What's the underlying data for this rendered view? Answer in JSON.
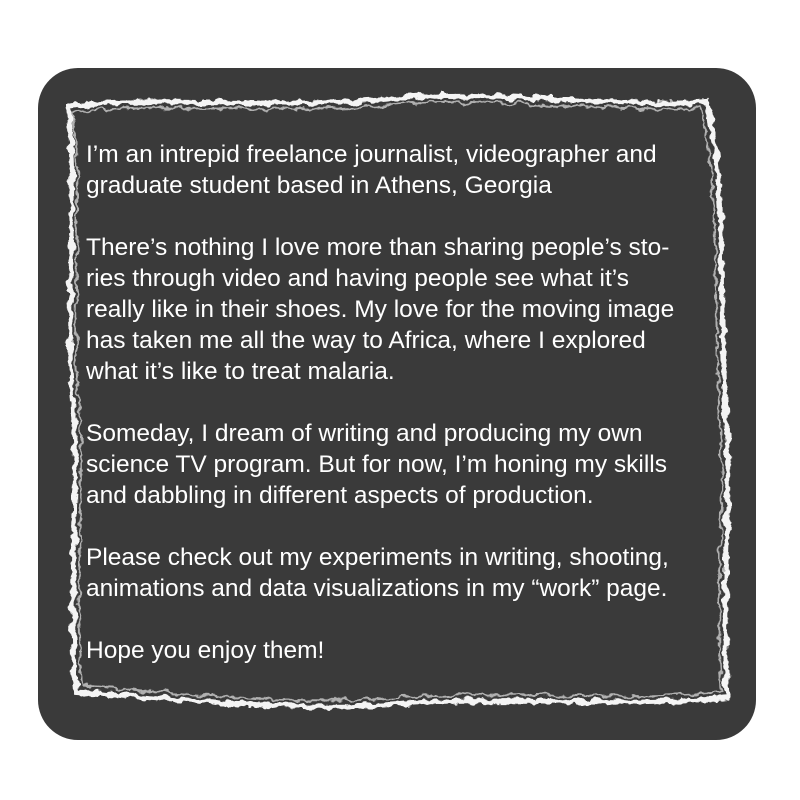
{
  "card": {
    "background_color": "#3a3a3a",
    "frame_color": "#ffffff",
    "paragraphs": [
      "I’m  an intrepid freelance journalist, videographer and\ngraduate student  based in Athens, Georgia",
      "There’s nothing I love more than sharing people’s sto-\nries through video and having people see what it’s\nreally like in their shoes. My love for the moving image\nhas taken me all the way to Africa, where I explored\nwhat it’s like to treat malaria.",
      "Someday, I dream of writing and producing my own\nscience TV program.  But for now, I’m honing my skills\nand dabbling in different aspects of production.",
      "Please check out my experiments in writing, shooting,\nanimations and data visualizations in my “work” page.",
      "Hope you enjoy them!"
    ]
  }
}
